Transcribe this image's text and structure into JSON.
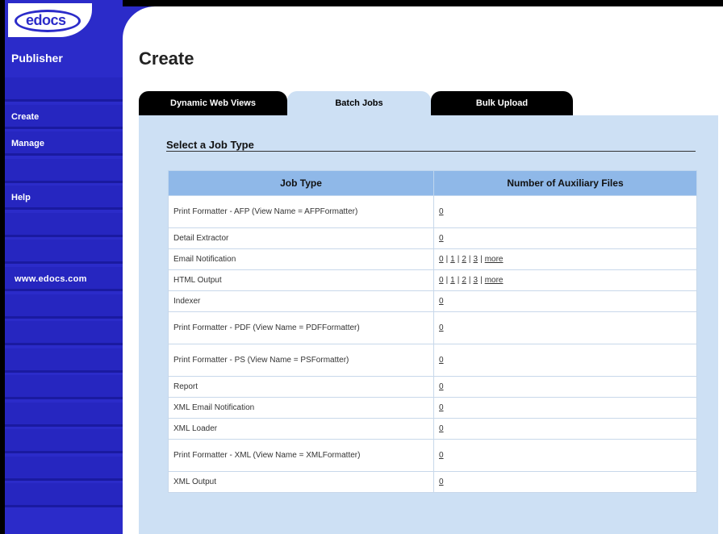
{
  "app": {
    "logo_text": "edocs",
    "brand": "Publisher",
    "nav": [
      {
        "label": "Create"
      },
      {
        "label": "Manage"
      },
      {
        "label": "Help"
      }
    ],
    "site_link": "www.edocs.com"
  },
  "page": {
    "title": "Create",
    "tabs": [
      {
        "label": "Dynamic Web Views"
      },
      {
        "label": "Batch Jobs"
      },
      {
        "label": "Bulk Upload"
      }
    ],
    "section_title": "Select a Job Type"
  },
  "table": {
    "headers": [
      "Job Type",
      "Number of Auxiliary Files"
    ],
    "rows": [
      {
        "type": "Print Formatter - AFP (View Name = AFPFormatter)",
        "files": [
          "0"
        ],
        "more": ""
      },
      {
        "type": "Detail Extractor",
        "files": [
          "0"
        ],
        "more": ""
      },
      {
        "type": "Email Notification",
        "files": [
          "0",
          "1",
          "2",
          "3"
        ],
        "more": "more"
      },
      {
        "type": "HTML Output",
        "files": [
          "0",
          "1",
          "2",
          "3"
        ],
        "more": "more"
      },
      {
        "type": "Indexer",
        "files": [
          "0"
        ],
        "more": ""
      },
      {
        "type": "Print Formatter - PDF (View Name = PDFFormatter)",
        "files": [
          "0"
        ],
        "more": ""
      },
      {
        "type": "Print Formatter - PS (View Name = PSFormatter)",
        "files": [
          "0"
        ],
        "more": ""
      },
      {
        "type": "Report",
        "files": [
          "0"
        ],
        "more": ""
      },
      {
        "type": "XML Email Notification",
        "files": [
          "0"
        ],
        "more": ""
      },
      {
        "type": "XML Loader",
        "files": [
          "0"
        ],
        "more": ""
      },
      {
        "type": "Print Formatter - XML (View Name = XMLFormatter)",
        "files": [
          "0"
        ],
        "more": ""
      },
      {
        "type": "XML Output",
        "files": [
          "0"
        ],
        "more": ""
      }
    ]
  },
  "colors": {
    "sidebar": "#2b2bc9",
    "panel": "#cde0f4",
    "header": "#8fb8e8"
  }
}
